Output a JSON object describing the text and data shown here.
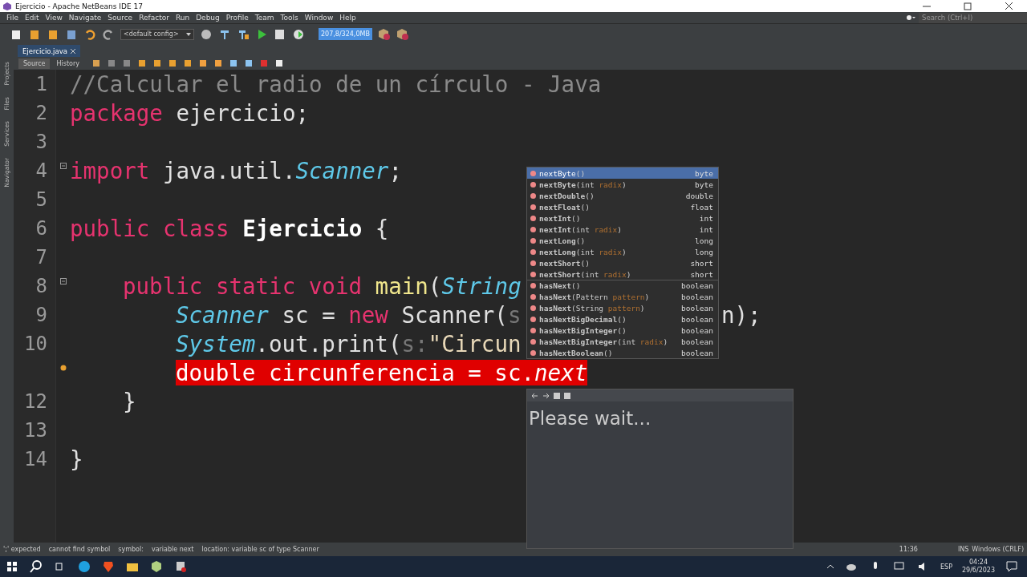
{
  "window": {
    "title": "Ejercicio - Apache NetBeans IDE 17"
  },
  "menu": [
    "File",
    "Edit",
    "View",
    "Navigate",
    "Source",
    "Refactor",
    "Run",
    "Debug",
    "Profile",
    "Team",
    "Tools",
    "Window",
    "Help"
  ],
  "search": {
    "placeholder": "Search (Ctrl+I)"
  },
  "toolbar": {
    "config": "<default config>",
    "memory": "207,8/324,0MB"
  },
  "side_tabs": [
    "Projects",
    "Files",
    "Services",
    "Navigator"
  ],
  "editor_tabs": [
    {
      "label": "Ejercicio.java",
      "selected": true
    }
  ],
  "view_tabs": [
    {
      "label": "Source",
      "selected": true
    },
    {
      "label": "History",
      "selected": false
    }
  ],
  "code": [
    {
      "kind": "code",
      "number": "1",
      "tokens": [
        {
          "kind": "comment",
          "text": "//Calcular el radio de un círculo - Java"
        }
      ]
    },
    {
      "kind": "code",
      "number": "2",
      "tokens": [
        {
          "kind": "keyword",
          "text": "package"
        },
        {
          "kind": "plain",
          "text": " ejercicio;"
        }
      ]
    },
    {
      "kind": "code",
      "number": "3"
    },
    {
      "kind": "fold",
      "number": "4",
      "tokens": [
        {
          "kind": "keyword",
          "text": "import"
        },
        {
          "kind": "plain",
          "text": " java.util."
        },
        {
          "kind": "type",
          "text": "Scanner"
        },
        {
          "kind": "plain",
          "text": ";"
        }
      ]
    },
    {
      "kind": "code",
      "number": "5"
    },
    {
      "kind": "code",
      "number": "6",
      "tokens": [
        {
          "kind": "keyword",
          "text": "public class "
        },
        {
          "kind": "classname",
          "text": "Ejercicio"
        },
        {
          "kind": "plain",
          "text": " {"
        }
      ],
      "children": [
        {
          "kind": "code",
          "number": "7"
        },
        {
          "kind": "fold",
          "number": "8",
          "tokens": [
            {
              "kind": "keyword",
              "text": "public static void "
            },
            {
              "kind": "method",
              "text": "main"
            },
            {
              "kind": "plain",
              "text": "("
            },
            {
              "kind": "type",
              "text": "String"
            }
          ],
          "children": [
            {
              "kind": "code",
              "number": "9",
              "tokens": [
                {
                  "kind": "type",
                  "text": "Scanner"
                },
                {
                  "kind": "plain",
                  "text": " sc = "
                },
                {
                  "kind": "keyword",
                  "text": "new"
                },
                {
                  "kind": "plain",
                  "text": " Scanner("
                },
                {
                  "kind": "hint",
                  "text": "s"
                }
              ],
              "tail": "n);"
            },
            {
              "kind": "code",
              "number": "10",
              "tokens": [
                {
                  "kind": "type",
                  "text": "System"
                },
                {
                  "kind": "plain",
                  "text": ".out.print("
                },
                {
                  "kind": "hint",
                  "text": "s:"
                },
                {
                  "kind": "string",
                  "text": "\"Circun"
                }
              ]
            },
            {
              "kind": "error",
              "tokens": [
                {
                  "kind": "plain",
                  "text": "double circunferencia = sc."
                },
                {
                  "kind": "type",
                  "text": "next"
                }
              ]
            }
          ]
        },
        {
          "kind": "code",
          "number": "12",
          "tokens": [
            {
              "kind": "plain",
              "text": "}"
            }
          ]
        }
      ]
    },
    {
      "kind": "code",
      "number": "13"
    },
    {
      "kind": "code",
      "number": "14",
      "tokens": [
        {
          "kind": "plain",
          "text": "}"
        }
      ]
    }
  ],
  "completion": [
    {
      "selected": true,
      "separator": false,
      "type": "byte",
      "parts": [
        {
          "kind": "name",
          "text": "nextByte"
        },
        {
          "kind": "plain",
          "text": "()"
        }
      ]
    },
    {
      "selected": false,
      "separator": false,
      "type": "byte",
      "parts": [
        {
          "kind": "name",
          "text": "nextByte"
        },
        {
          "kind": "plain",
          "text": "(int "
        },
        {
          "kind": "param",
          "text": "radix"
        },
        {
          "kind": "plain",
          "text": ")"
        }
      ]
    },
    {
      "selected": false,
      "separator": false,
      "type": "double",
      "parts": [
        {
          "kind": "name",
          "text": "nextDouble"
        },
        {
          "kind": "plain",
          "text": "()"
        }
      ]
    },
    {
      "selected": false,
      "separator": false,
      "type": "float",
      "parts": [
        {
          "kind": "name",
          "text": "nextFloat"
        },
        {
          "kind": "plain",
          "text": "()"
        }
      ]
    },
    {
      "selected": false,
      "separator": false,
      "type": "int",
      "parts": [
        {
          "kind": "name",
          "text": "nextInt"
        },
        {
          "kind": "plain",
          "text": "()"
        }
      ]
    },
    {
      "selected": false,
      "separator": false,
      "type": "int",
      "parts": [
        {
          "kind": "name",
          "text": "nextInt"
        },
        {
          "kind": "plain",
          "text": "(int "
        },
        {
          "kind": "param",
          "text": "radix"
        },
        {
          "kind": "plain",
          "text": ")"
        }
      ]
    },
    {
      "selected": false,
      "separator": false,
      "type": "long",
      "parts": [
        {
          "kind": "name",
          "text": "nextLong"
        },
        {
          "kind": "plain",
          "text": "()"
        }
      ]
    },
    {
      "selected": false,
      "separator": false,
      "type": "long",
      "parts": [
        {
          "kind": "name",
          "text": "nextLong"
        },
        {
          "kind": "plain",
          "text": "(int "
        },
        {
          "kind": "param",
          "text": "radix"
        },
        {
          "kind": "plain",
          "text": ")"
        }
      ]
    },
    {
      "selected": false,
      "separator": false,
      "type": "short",
      "parts": [
        {
          "kind": "name",
          "text": "nextShort"
        },
        {
          "kind": "plain",
          "text": "()"
        }
      ]
    },
    {
      "selected": false,
      "separator": false,
      "type": "short",
      "parts": [
        {
          "kind": "name",
          "text": "nextShort"
        },
        {
          "kind": "plain",
          "text": "(int "
        },
        {
          "kind": "param",
          "text": "radix"
        },
        {
          "kind": "plain",
          "text": ")"
        }
      ]
    },
    {
      "selected": false,
      "separator": true,
      "type": "boolean",
      "parts": [
        {
          "kind": "name",
          "text": "hasNext"
        },
        {
          "kind": "plain",
          "text": "()"
        }
      ]
    },
    {
      "selected": false,
      "separator": false,
      "type": "boolean",
      "parts": [
        {
          "kind": "name",
          "text": "hasNext"
        },
        {
          "kind": "plain",
          "text": "(Pattern "
        },
        {
          "kind": "param",
          "text": "pattern"
        },
        {
          "kind": "plain",
          "text": ")"
        }
      ]
    },
    {
      "selected": false,
      "separator": false,
      "type": "boolean",
      "parts": [
        {
          "kind": "name",
          "text": "hasNext"
        },
        {
          "kind": "plain",
          "text": "(String "
        },
        {
          "kind": "param",
          "text": "pattern"
        },
        {
          "kind": "plain",
          "text": ")"
        }
      ]
    },
    {
      "selected": false,
      "separator": false,
      "type": "boolean",
      "parts": [
        {
          "kind": "name",
          "text": "hasNextBigDecimal"
        },
        {
          "kind": "plain",
          "text": "()"
        }
      ]
    },
    {
      "selected": false,
      "separator": false,
      "type": "boolean",
      "parts": [
        {
          "kind": "name",
          "text": "hasNextBigInteger"
        },
        {
          "kind": "plain",
          "text": "()"
        }
      ]
    },
    {
      "selected": false,
      "separator": false,
      "type": "boolean",
      "parts": [
        {
          "kind": "name",
          "text": "hasNextBigInteger"
        },
        {
          "kind": "plain",
          "text": "(int "
        },
        {
          "kind": "param",
          "text": "radix"
        },
        {
          "kind": "plain",
          "text": ")"
        }
      ]
    },
    {
      "selected": false,
      "separator": false,
      "type": "boolean",
      "parts": [
        {
          "kind": "name",
          "text": "hasNextBoolean"
        },
        {
          "kind": "plain",
          "text": "()"
        }
      ]
    }
  ],
  "doc_popup": {
    "message": "Please wait..."
  },
  "status_bar": {
    "messages": [
      "';' expected",
      "cannot find symbol",
      "symbol:",
      "variable next",
      "location: variable sc of type Scanner"
    ],
    "position": "11:36",
    "mode": "INS",
    "line_ending": "Windows (CRLF)"
  },
  "taskbar": {
    "language": "ESP",
    "time": "04:24",
    "date": "29/6/2023"
  }
}
